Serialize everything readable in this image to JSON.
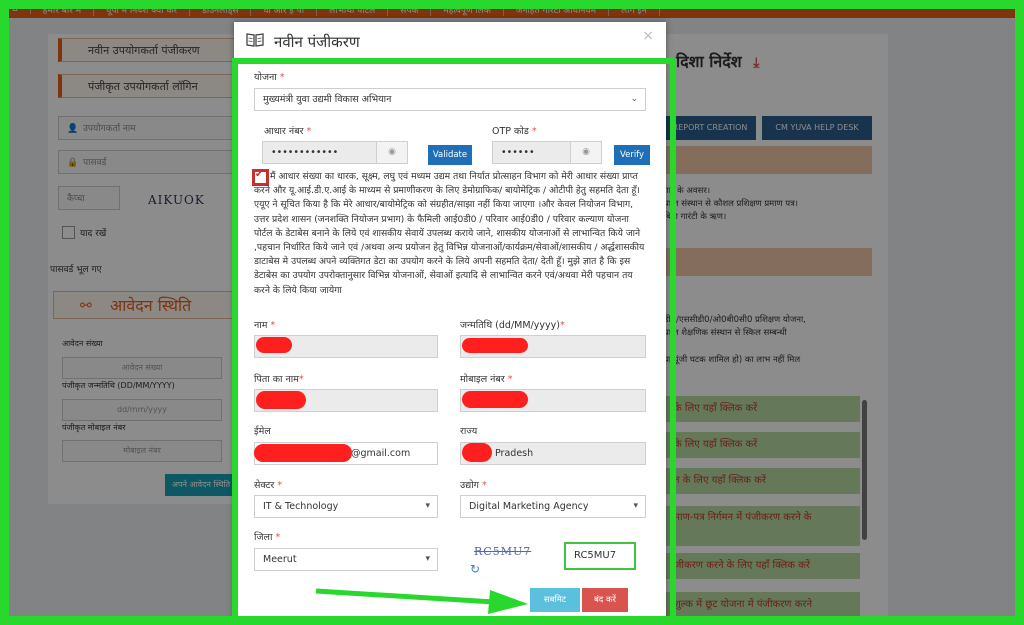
{
  "topnav": [
    "⌂",
    "हमारे बारे में",
    "यूपी में निवेश क्यों करें",
    "डाउनलोड्स",
    "वी आर ई पी",
    "लाभार्थी पोर्टल",
    "संपर्क",
    "महत्वपूर्ण लिंक",
    "जनहित गारंटी अधिनियम",
    "लॉग इन"
  ],
  "left": {
    "new_user_tab": "नवीन उपयोगकर्ता पंजीकरण",
    "registered_user_tab": "पंजीकृत उपयोगकर्ता लॉगिन",
    "username_placeholder": "उपयोगकर्ता नाम",
    "password_placeholder": "पासवर्ड",
    "captcha_placeholder": "कैप्चा",
    "captcha_code": "AIKUOK",
    "remember_label": "याद रखें",
    "forgot_password": "पासवर्ड भूल गए",
    "status_title": "आवेदन स्थिति",
    "app_no_label": "आवेदन संख्या",
    "app_no_placeholder": "आवेदन संख्या",
    "dob_label": "पंजीकृत जन्मतिथि (DD/MM/YYYY)",
    "dob_placeholder": "dd/mm/yyyy",
    "mobile_label": "पंजीकृत मोबाइल नंबर",
    "mobile_placeholder": "मोबाइल नंबर",
    "status_button": "अपने आवेदन स्थिति"
  },
  "right": {
    "title": "दिशा निर्देश",
    "btn_report": "REPORT CREATION",
    "btn_help": "CM YUVA HELP DESK",
    "lines": [
      "गार के अवसर।",
      "प्राप्त संस्थान से कौशल प्रशिक्षण प्रमाण पत्र।",
      "बिना गारंटी के ऋण।",
      "डी0/एससीडी0/ओ0बी0सी0 प्रशिक्षण योजना,",
      "प्राप्त शैक्षणिक संस्थान से स्किल सम्बन्धी",
      "या पूंजी घटक शामिल हो) का लाभ नहीं मिल"
    ],
    "links": [
      "के लिए यहाँ क्लिक करें",
      "के लिए यहाँ क्लिक करें",
      "न के लिए यहाँ क्लिक करें",
      "माण-पत्र निर्गमन में पंजीकरण करने के",
      "जीकरण करने के लिए यहाँ क्लिक करें",
      "शुल्क में छूट योजना में पंजीकरण करने"
    ]
  },
  "modal": {
    "title": "नवीन पंजीकरण",
    "close": "×",
    "scheme_label": "योजना",
    "scheme_value": "मुख्यमंत्री युवा उद्यमी विकास अभियान",
    "aadhaar_label": "आधार नंबर",
    "aadhaar_value": "••••••••••••",
    "validate_button": "Validate",
    "otp_label": "OTP कोड",
    "otp_value": "••••••",
    "verify_button": "Verify",
    "consent_text": "मैं आधार संख्या का धारक, सूक्ष्म, लघु एवं मध्यम उद्यम तथा निर्यात प्रोत्साहन विभाग को मेरी आधार संख्या प्राप्त करने और यू.आई.डी.ए.आई के माध्यम से प्रमाणीकरण के लिए डेमोग्राफिक/ बायोमेट्रिक / ओटीपी हेतु सहमति देता हूँ।एयूए ने सूचित किया है कि मेरे आधार/बायोमेट्रिक को संग्रहीत/साझा नहीं किया जाएगा ।और केवल नियोजन विभाग, उत्तर प्रदेश शासन (जनशक्ति नियोजन प्रभाग) के फैमिली आई0डी0 / परिवार आई0डी0 / परिवार कल्याण योजना पोर्टल के डेटाबेस बनाने के लिये एवं शासकीय सेवायें उपलब्ध कराये जाने, शासकीय योजनाओं से लाभान्वित किये जाने ,पहचान निर्धारित किये जाने एवं /अथवा अन्य प्रयोजन हेतु विभिन्न योजनाओं/कार्यक्रम/सेवाओं/शासकीय / अर्द्धशासकीय डाटाबेस मे उपलब्ध अपने व्यक्तिगत डेटा का उपयोग करने के लिये अपनी सहमति देता/ देती हूँ। मुझे ज्ञात है कि इस डेटाबेस का उपयोग उपरोक्तानुसार विभिन्न योजनाओं, सेवाओं इत्यादि से लाभान्वित करने एवं/अथवा मेरी पहचान तय करने के लिये किया जायेगा",
    "name_label": "नाम",
    "dob_label": "जन्मतिथि (dd/MM/yyyy)",
    "father_label": "पिता का नाम",
    "mobile_label": "मोबाइल नंबर",
    "email_label": "ईमेल",
    "email_value": "@gmail.com",
    "state_label": "राज्य",
    "state_value": "Pradesh",
    "sector_label": "सेक्टर",
    "sector_value": "IT & Technology",
    "industry_label": "उद्योग",
    "industry_value": "Digital Marketing Agency",
    "district_label": "जिला",
    "district_value": "Meerut",
    "captcha_image": "RC5MU7",
    "captcha_input": "RC5MU7",
    "submit_button": "सबमिट",
    "cancel_button": "बंद करें"
  },
  "colors": {
    "accent_orange": "#e85d1c",
    "annotation_green": "#28d82c",
    "redaction_red": "#ff1f1f",
    "submit_blue": "#5bc0de",
    "cancel_red": "#d9534f"
  }
}
